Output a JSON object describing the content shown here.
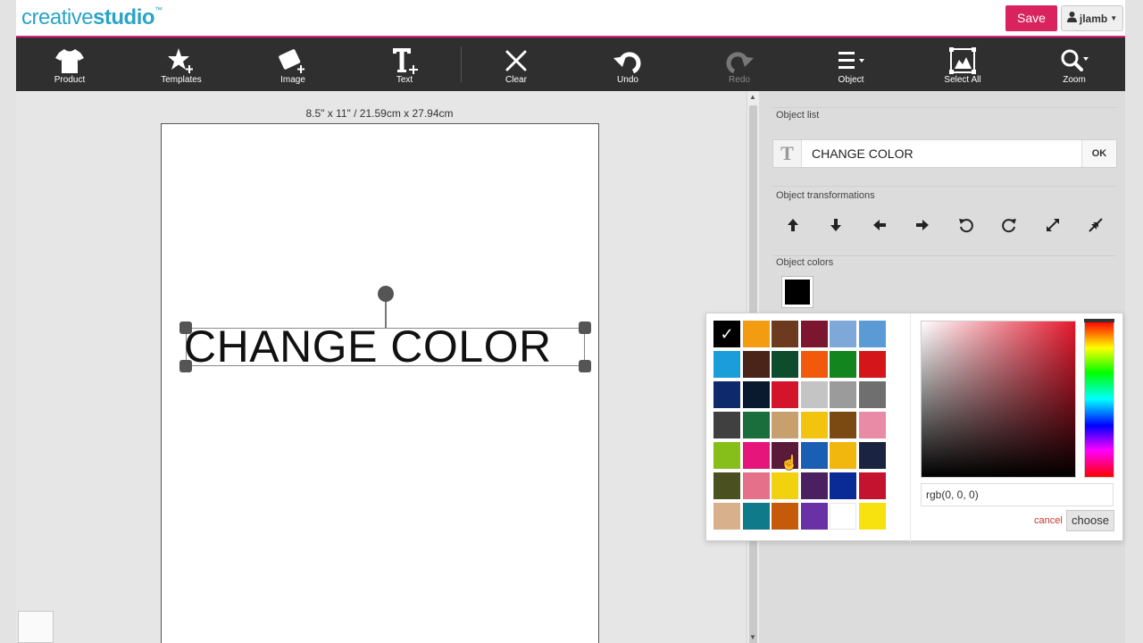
{
  "app": {
    "logo_part1": "creative",
    "logo_part2": "studio",
    "logo_tm": "™",
    "save_label": "Save",
    "user_name": "jlamb"
  },
  "toolbar": {
    "product": "Product",
    "templates": "Templates",
    "image": "Image",
    "text": "Text",
    "clear": "Clear",
    "undo": "Undo",
    "redo": "Redo",
    "object": "Object",
    "select_all": "Select All",
    "zoom": "Zoom"
  },
  "canvas": {
    "dimensions": "8.5\" x 11\" / 21.59cm x 27.94cm",
    "text": "CHANGE COLOR"
  },
  "panel": {
    "object_list_label": "Object list",
    "object_text_value": "CHANGE COLOR",
    "ok_label": "OK",
    "transformations_label": "Object transformations",
    "colors_label": "Object colors",
    "current_color": "#000000"
  },
  "color_picker": {
    "swatches": [
      "#000000",
      "#f39c12",
      "#6b3a1f",
      "#7b1530",
      "#7ea8d8",
      "#5b9bd5",
      "#1a9ed9",
      "#4a2418",
      "#0d4d2e",
      "#f05a0a",
      "#12851f",
      "#d4161b",
      "#0e2a6b",
      "#0a1a2e",
      "#d4142b",
      "#c4c4c4",
      "#9b9b9b",
      "#6f6f6f",
      "#404040",
      "#1a6e3c",
      "#c8a06e",
      "#f2c40f",
      "#7b4a12",
      "#e98aa6",
      "#86bf1a",
      "#e5157c",
      "#5a1a3a",
      "#1a5fb4",
      "#f2b70f",
      "#1a2340",
      "#4a5020",
      "#e5708a",
      "#f2d10f",
      "#4a2060",
      "#0a2a96",
      "#c4132f",
      "#d9b08c",
      "#0f7a8a",
      "#c45a0a",
      "#6a30a6",
      "#ffffff",
      "#f7e10f"
    ],
    "selected_index": 0,
    "selected_mark": "✓",
    "rgb_value": "rgb(0, 0, 0)",
    "cancel_label": "cancel",
    "choose_label": "choose"
  }
}
